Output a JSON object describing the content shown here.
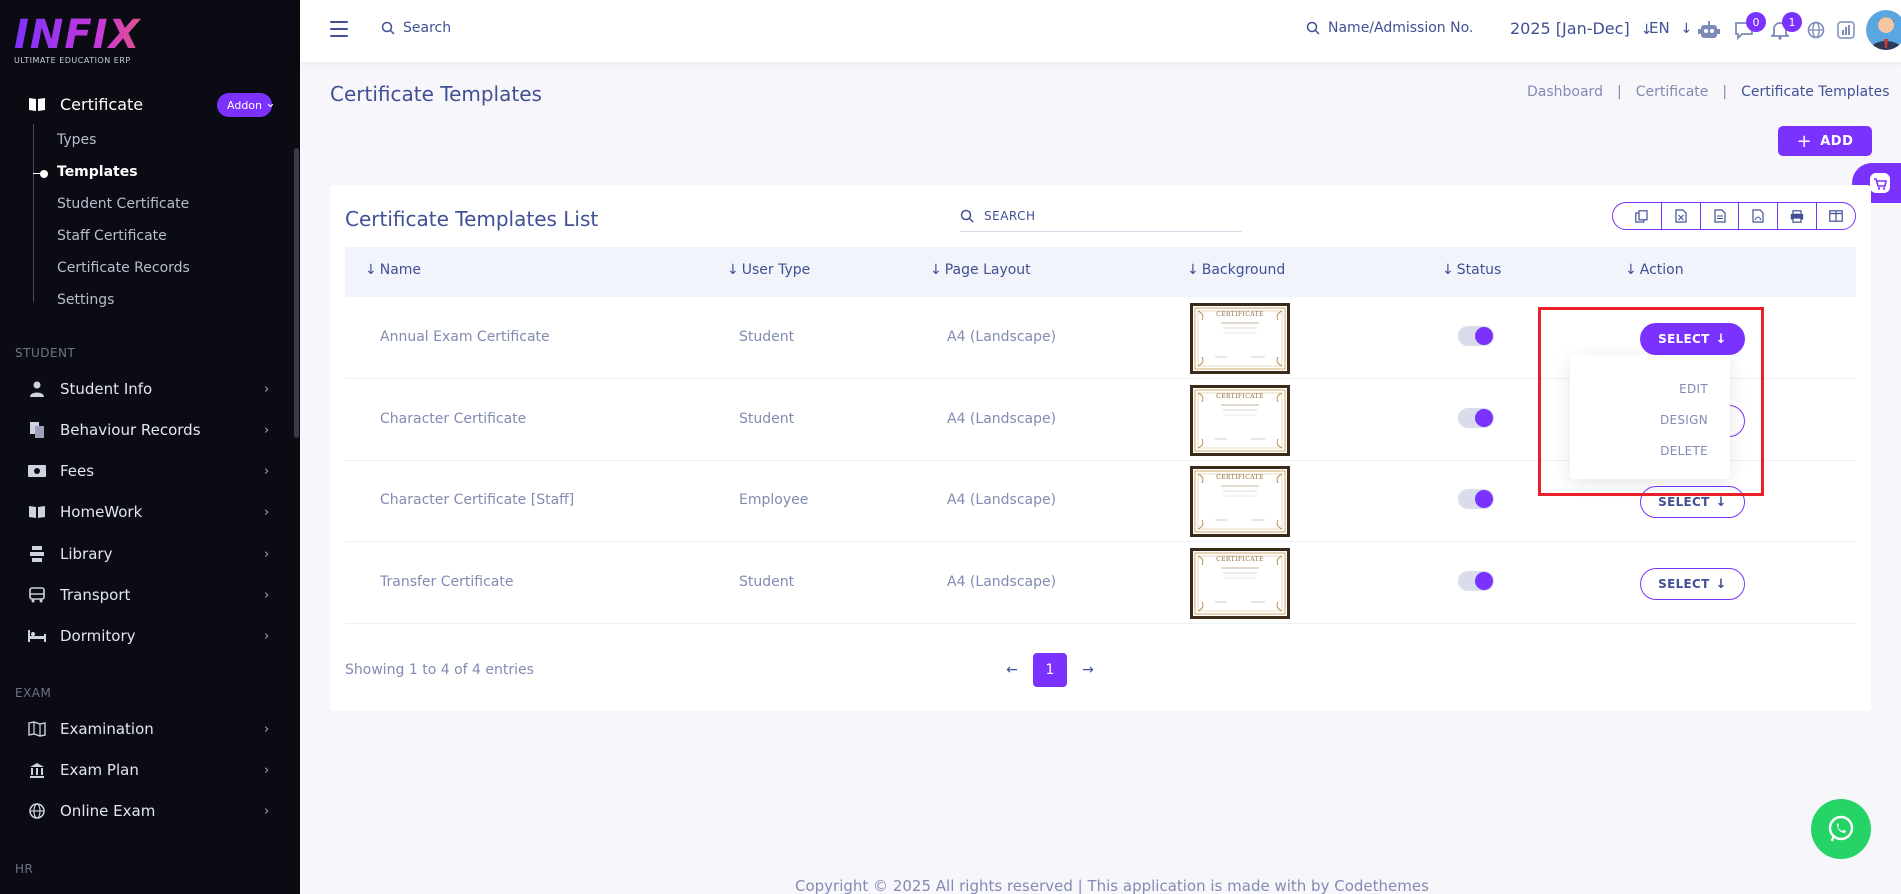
{
  "sidebar": {
    "logo": {
      "word": "INFIX",
      "tagline": "ULTIMATE EDUCATION ERP"
    },
    "certificate_menu": {
      "label": "Certificate",
      "badge": "Addon",
      "children": [
        "Types",
        "Templates",
        "Student Certificate",
        "Staff Certificate",
        "Certificate Records",
        "Settings"
      ],
      "active": "Templates"
    },
    "sections": {
      "student": "STUDENT",
      "exam": "EXAM",
      "hr": "HR"
    },
    "student_items": [
      "Student Info",
      "Behaviour Records",
      "Fees",
      "HomeWork",
      "Library",
      "Transport",
      "Dormitory"
    ],
    "exam_items": [
      "Examination",
      "Exam Plan",
      "Online Exam"
    ]
  },
  "topbar": {
    "search_label": "Search",
    "student_search_label": "Name/Admission No.",
    "session": "2025 [Jan-Dec]",
    "language": "EN",
    "chat_badge": "0",
    "notification_badge": "1"
  },
  "header": {
    "title": "Certificate Templates",
    "breadcrumb": [
      "Dashboard",
      "Certificate",
      "Certificate Templates"
    ],
    "breadcrumb_sep": "|",
    "add_label": "ADD"
  },
  "table": {
    "title": "Certificate Templates List",
    "search_placeholder": "SEARCH",
    "columns": [
      "Name",
      "User Type",
      "Page Layout",
      "Background",
      "Status",
      "Action"
    ],
    "rows": [
      {
        "name": "Annual Exam Certificate",
        "user_type": "Student",
        "layout": "A4 (Landscape)",
        "status": true,
        "action": "SELECT"
      },
      {
        "name": "Character Certificate",
        "user_type": "Student",
        "layout": "A4 (Landscape)",
        "status": true,
        "action": "SELECT"
      },
      {
        "name": "Character Certificate [Staff]",
        "user_type": "Employee",
        "layout": "A4 (Landscape)",
        "status": true,
        "action": "SELECT"
      },
      {
        "name": "Transfer Certificate",
        "user_type": "Student",
        "layout": "A4 (Landscape)",
        "status": true,
        "action": "SELECT"
      }
    ],
    "certificate_thumb_text": "CERTIFICATE",
    "dropdown_items": [
      "EDIT",
      "DESIGN",
      "DELETE"
    ],
    "showing": "Showing 1 to 4 of 4 entries",
    "current_page": "1"
  },
  "footer": {
    "text": "Copyright © 2025 All rights reserved | This application is made with by Codethemes"
  },
  "colors": {
    "accent": "#7c32ff",
    "sidebar_bg": "#0b0b14",
    "text": "#415094",
    "muted": "#828bb2",
    "highlight": "#e8202a",
    "whatsapp": "#25d366"
  }
}
